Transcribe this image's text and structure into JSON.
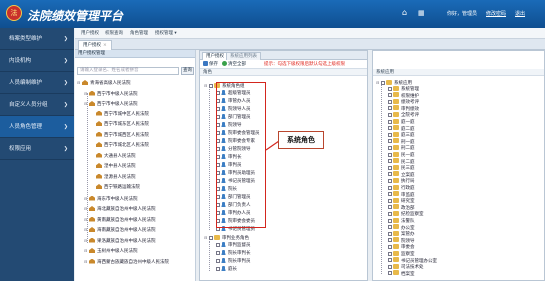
{
  "header": {
    "app_title": "法院绩效管理平台",
    "logo_glyph": "法",
    "home_icon": "home-icon",
    "apps_icon": "grid-icon",
    "greeting": "你好，管理员",
    "change_password": "修改密码",
    "logout": "退出"
  },
  "sidebar": {
    "items": [
      {
        "label": "档案类型维护",
        "active": false
      },
      {
        "label": "内设机构",
        "active": false
      },
      {
        "label": "人员编制维护",
        "active": false
      },
      {
        "label": "自定义人员分组",
        "active": false
      },
      {
        "label": "人员角色管理",
        "active": true
      },
      {
        "label": "权限应用",
        "active": false
      }
    ]
  },
  "page_tabs": [
    "用户授权",
    "权限查询",
    "角色管理",
    "授权管理"
  ],
  "sub_tab": {
    "label": "用户授权"
  },
  "left_panel": {
    "title": "用户授权管理",
    "search_placeholder": "请输入登录名、姓名或者拼音",
    "search_button": "查询",
    "tree": [
      {
        "label": "青海省高级人民法院",
        "level": 0,
        "type": "home"
      },
      {
        "label": "西宁市中级人民法院",
        "level": 1,
        "type": "home"
      },
      {
        "label": "西宁市中级人民法院",
        "level": 1,
        "type": "home"
      },
      {
        "label": "西宁市城中区人民法院",
        "level": 2,
        "type": "home"
      },
      {
        "label": "西宁市城东区人民法院",
        "level": 2,
        "type": "home"
      },
      {
        "label": "西宁市城西区人民法院",
        "level": 2,
        "type": "home"
      },
      {
        "label": "西宁市城北区人民法院",
        "level": 2,
        "type": "home"
      },
      {
        "label": "大通县人民法院",
        "level": 2,
        "type": "home"
      },
      {
        "label": "湟中县人民法院",
        "level": 2,
        "type": "home"
      },
      {
        "label": "湟源县人民法院",
        "level": 2,
        "type": "home"
      },
      {
        "label": "西宁铁路运输法院",
        "level": 2,
        "type": "home"
      },
      {
        "label": "海东市中级人民法院",
        "level": 1,
        "type": "home"
      },
      {
        "label": "海北藏族自治州中级人民法院",
        "level": 1,
        "type": "home"
      },
      {
        "label": "黄南藏族自治州中级人民法院",
        "level": 1,
        "type": "home"
      },
      {
        "label": "海南藏族自治州中级人民法院",
        "level": 1,
        "type": "home"
      },
      {
        "label": "果洛藏族自治州中级人民法院",
        "level": 1,
        "type": "home"
      },
      {
        "label": "玉树州中级人民法院",
        "level": 1,
        "type": "home"
      },
      {
        "label": "海西蒙古族藏族自治州中级人民法院",
        "level": 1,
        "type": "home"
      }
    ]
  },
  "middle_panel": {
    "tabs": [
      "用户授权",
      "系统应用列表"
    ],
    "save_label": "保存",
    "clear_label": "清空全部",
    "hint": "提示：勾选下级权限后默认勾选上级权限",
    "column_header": "角色",
    "group_sys": "系统角色组",
    "sys_roles": [
      "超级管理员",
      "审管办人员",
      "院领导人员",
      "部门管理员",
      "院领导",
      "院审委会管理员",
      "院审委会专家",
      "分管院领导",
      "审判长",
      "审判员",
      "审判员助理员",
      "书记员管理员",
      "院长",
      "部门管理员",
      "部门负责人",
      "审判办人员",
      "院审委会委员",
      "书记员管理员"
    ],
    "group_biz": "审判业务角色",
    "biz_roles": [
      "审判监督员",
      "院长审判长",
      "院长审判员",
      "庭长"
    ],
    "callout": "系统角色"
  },
  "right_panel": {
    "column_header": "系统应用",
    "root": "系统应用",
    "items": [
      "系统管理",
      "权限维护",
      "绩效考评",
      "审判绩效",
      "全院考评",
      "庭一庭",
      "庭二庭",
      "庭三庭",
      "刑一庭",
      "刑二庭",
      "民一庭",
      "民二庭",
      "民三庭",
      "立案庭",
      "执行局",
      "行政庭",
      "审监庭",
      "研究室",
      "政治部",
      "纪检监察室",
      "法警队",
      "办公室",
      "案管办",
      "院领导",
      "审委会",
      "监察室",
      "书记员管理办公室",
      "司法技术处",
      "档案室"
    ]
  },
  "colors": {
    "header": "#1a6bb8",
    "sidebar": "#234a73",
    "sidebar_active": "#1c5d9e",
    "annotation": "#d3261e",
    "hint": "#e0241b"
  }
}
